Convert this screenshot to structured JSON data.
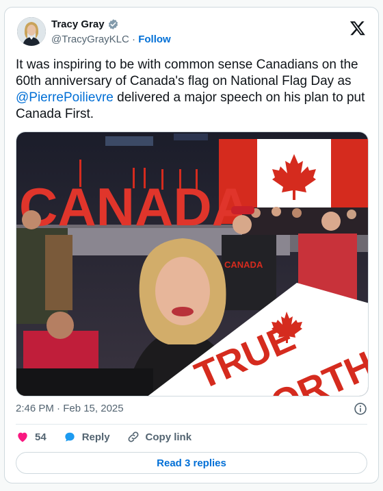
{
  "author": {
    "name": "Tracy Gray",
    "handle": "@TracyGrayKLC",
    "separator": "·",
    "follow_label": "Follow"
  },
  "tweet": {
    "text_before": "It was inspiring to be with common sense Canadians on the 60th anniversary of Canada's flag on National Flag Day as ",
    "mention": "@PierrePoilievre",
    "text_after": " delivered a major speech on his plan to put Canada First.",
    "timestamp": "2:46 PM · Feb 15, 2025"
  },
  "photo": {
    "sign_letters": "CANADA",
    "placard_text_1": "TRUE",
    "placard_text_2": "ORTH",
    "shirt_text": "CANADA"
  },
  "actions": {
    "like_count": "54",
    "reply_label": "Reply",
    "copy_label": "Copy link"
  },
  "replies_label": "Read 3 replies",
  "colors": {
    "accent": "#006fd6",
    "like": "#f91880",
    "reply_icon": "#1d9bf0",
    "canada_red": "#d52b1e"
  },
  "icons": [
    "verified-badge-icon",
    "x-logo-icon",
    "info-icon",
    "heart-icon",
    "reply-bubble-icon",
    "link-icon"
  ]
}
